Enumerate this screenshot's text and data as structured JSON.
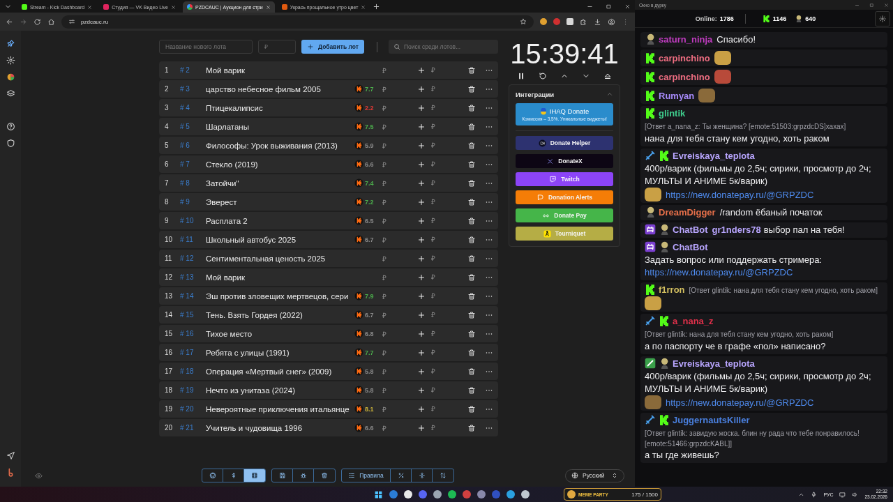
{
  "browser": {
    "tabs": [
      {
        "title": "Stream - Kick Dashboard",
        "selected": false
      },
      {
        "title": "Студия — VK Видео Live",
        "selected": false
      },
      {
        "title": "PZDCAUC | Аукцион для стри",
        "selected": true
      },
      {
        "title": "Укрась прощальное утро цвет",
        "selected": false
      }
    ],
    "address": "pzdcauc.ru"
  },
  "lot_form": {
    "name_placeholder": "Название нового лота",
    "amount_placeholder": "₽",
    "add_button": "Добавить лот",
    "search_placeholder": "Поиск среди лотов..."
  },
  "lots": [
    {
      "index": "1",
      "id": "# 2",
      "name": "Мой варик",
      "amount": "₽",
      "bid_placeholder": "₽"
    },
    {
      "index": "2",
      "id": "# 3",
      "name": "царство небесное фильм 2005",
      "rating": "7.7",
      "color": "#4cae4c",
      "amount": "₽",
      "bid_placeholder": "₽"
    },
    {
      "index": "3",
      "id": "# 4",
      "name": "Птицекалипсис",
      "rating": "2.2",
      "color": "#e53935",
      "amount": "₽",
      "bid_placeholder": "₽"
    },
    {
      "index": "4",
      "id": "# 5",
      "name": "Шарлатаны",
      "rating": "7.5",
      "color": "#4cae4c",
      "amount": "₽",
      "bid_placeholder": "₽"
    },
    {
      "index": "5",
      "id": "# 6",
      "name": "Философы: Урок выживания (2013)",
      "rating": "5.9",
      "color": "#8a8a8a",
      "amount": "₽",
      "bid_placeholder": "₽"
    },
    {
      "index": "6",
      "id": "# 7",
      "name": "Стекло (2019)",
      "rating": "6.6",
      "color": "#8a8a8a",
      "amount": "₽",
      "bid_placeholder": "₽"
    },
    {
      "index": "7",
      "id": "# 8",
      "name": "Затойчи\"",
      "rating": "7.4",
      "color": "#4cae4c",
      "amount": "₽",
      "bid_placeholder": "₽"
    },
    {
      "index": "8",
      "id": "# 9",
      "name": "Эверест",
      "rating": "7.2",
      "color": "#4cae4c",
      "amount": "₽",
      "bid_placeholder": "₽"
    },
    {
      "index": "9",
      "id": "# 10",
      "name": "Расплата 2",
      "rating": "6.5",
      "color": "#8a8a8a",
      "amount": "₽",
      "bid_placeholder": "₽"
    },
    {
      "index": "10",
      "id": "# 11",
      "name": "Школьный автобус 2025",
      "rating": "6.7",
      "color": "#8a8a8a",
      "amount": "₽",
      "bid_placeholder": "₽"
    },
    {
      "index": "11",
      "id": "# 12",
      "name": "Сентиментальная ценость 2025",
      "amount": "₽",
      "bid_placeholder": "₽"
    },
    {
      "index": "12",
      "id": "# 13",
      "name": "Мой варик",
      "amount": "₽",
      "bid_placeholder": "₽"
    },
    {
      "index": "13",
      "id": "# 14",
      "name": "Эш против зловещих мертвецов, сери",
      "rating": "7.9",
      "color": "#4cae4c",
      "amount": "₽",
      "bid_placeholder": "₽"
    },
    {
      "index": "14",
      "id": "# 15",
      "name": "Тень. Взять Гордея (2022)",
      "rating": "6.7",
      "color": "#8a8a8a",
      "amount": "₽",
      "bid_placeholder": "₽"
    },
    {
      "index": "15",
      "id": "# 16",
      "name": "Тихое место",
      "rating": "6.8",
      "color": "#8a8a8a",
      "amount": "₽",
      "bid_placeholder": "₽"
    },
    {
      "index": "16",
      "id": "# 17",
      "name": "Ребята с улицы (1991)",
      "rating": "7.7",
      "color": "#4cae4c",
      "amount": "₽",
      "bid_placeholder": "₽"
    },
    {
      "index": "17",
      "id": "# 18",
      "name": "Операция «Мертвый снег» (2009)",
      "rating": "5.8",
      "color": "#8a8a8a",
      "amount": "₽",
      "bid_placeholder": "₽"
    },
    {
      "index": "18",
      "id": "# 19",
      "name": "Нечто из унитаза (2024)",
      "rating": "5.8",
      "color": "#8a8a8a",
      "amount": "₽",
      "bid_placeholder": "₽"
    },
    {
      "index": "19",
      "id": "# 20",
      "name": "Невероятные приключения итальянце",
      "rating": "8.1",
      "color": "#c9b23a",
      "amount": "₽",
      "bid_placeholder": "₽"
    },
    {
      "index": "20",
      "id": "# 21",
      "name": "Учитель и чудовища 1996",
      "rating": "6.6",
      "color": "#8a8a8a",
      "amount": "₽",
      "bid_placeholder": "₽"
    }
  ],
  "timer": {
    "time": "15:39:41"
  },
  "integrations": {
    "title": "Интеграции",
    "expanded": true,
    "featured": {
      "name": "IHAQ Donate",
      "note": "Комиссия – 3,5%. Уникальные виджеты!"
    },
    "services": [
      {
        "name": "Donate Helper",
        "kind": "helper",
        "color": "#2d3270"
      },
      {
        "name": "DonateX",
        "kind": "x",
        "color": "#0d0614"
      },
      {
        "name": "Twitch",
        "kind": "twitch",
        "color": "#8c44f7"
      },
      {
        "name": "Donation Alerts",
        "kind": "alerts",
        "color": "#f57d07"
      },
      {
        "name": "Donate Pay",
        "kind": "pay",
        "color": "#45b549"
      },
      {
        "name": "Tourniquet",
        "kind": "tourniquet",
        "color": "#b5ad45"
      }
    ]
  },
  "toolbar": {
    "groups": [
      [
        {
          "kind": "github",
          "selected": false
        },
        {
          "kind": "dollar",
          "selected": false
        },
        {
          "kind": "film",
          "selected": true
        }
      ],
      [
        {
          "kind": "save",
          "selected": false
        },
        {
          "kind": "bug",
          "selected": false
        },
        {
          "kind": "trash",
          "selected": false
        }
      ],
      [
        {
          "kind": "rules",
          "label": "Правила",
          "selected": false
        },
        {
          "kind": "percent",
          "selected": false
        },
        {
          "kind": "split",
          "selected": false
        },
        {
          "kind": "sort",
          "selected": false
        }
      ]
    ]
  },
  "language": "Русский",
  "chat": {
    "window_title": "Окно в дурку",
    "online_label": "Online:",
    "online": "1786",
    "kick_viewers": "1146",
    "other_viewers": "640",
    "messages": [
      {
        "badges": [
          {
            "kind": "avatar"
          }
        ],
        "user": "saturn_ninja",
        "color": "#c03cc0",
        "text": "Спасибо!"
      },
      {
        "badges": [
          {
            "kind": "kick"
          }
        ],
        "user": "carpinchino",
        "color": "#f06e82",
        "emote": true
      },
      {
        "badges": [
          {
            "kind": "kick"
          }
        ],
        "user": "carpinchino",
        "color": "#f06e82",
        "emote": true
      },
      {
        "badges": [
          {
            "kind": "kick"
          }
        ],
        "user": "Rumyan",
        "color": "#a78bfa",
        "emote": true
      },
      {
        "badges": [
          {
            "kind": "kick"
          }
        ],
        "user": "glintik",
        "color": "#3fcf8e",
        "reply": "[Ответ a_nana_z: Ты женщина? [emote:51503:grpzdcDS]хахах]",
        "text": "нана для тебя стану кем угодно, хоть раком"
      },
      {
        "badges": [
          {
            "kind": "sword"
          },
          {
            "kind": "kick"
          }
        ],
        "user": "Evreiskaya_teplota",
        "color": "#b9a6ff",
        "text": "400р/варик (фильмы до 2,5ч; сирики, просмотр до 2ч; МУЛЬТЫ И АНИМЕ 5к/варик)",
        "emote": true,
        "link": "https://new.donatepay.ru/@GRPZDC"
      },
      {
        "badges": [
          {
            "kind": "avatar"
          }
        ],
        "user": "DreamDigger",
        "color": "#e8704a",
        "text": "/random ёбаный початок"
      },
      {
        "badges": [
          {
            "kind": "bot"
          },
          {
            "kind": "avatar"
          }
        ],
        "user": "ChatBot",
        "color": "#b9a6ff",
        "mention": "gr1nders78",
        "text": "выбор пал на тебя!"
      },
      {
        "badges": [
          {
            "kind": "bot"
          },
          {
            "kind": "avatar"
          }
        ],
        "user": "ChatBot",
        "color": "#b9a6ff",
        "text": "Задать вопрос или поддержать стримера:",
        "link": "https://new.donatepay.ru/@GRPZDC"
      },
      {
        "badges": [
          {
            "kind": "kick"
          }
        ],
        "user": "f1rron",
        "color": "#d4c060",
        "reply": "[Ответ glintik: нана для тебя стану кем угодно, хоть раком]",
        "emote": true
      },
      {
        "badges": [
          {
            "kind": "sword"
          },
          {
            "kind": "kick"
          }
        ],
        "user": "a_nana_z",
        "color": "#e0304a",
        "reply": "[Ответ glintik: нана для тебя стану кем угодно, хоть раком]",
        "text": "а по паспорту че в графе «пол» написано?"
      },
      {
        "badges": [
          {
            "kind": "check"
          },
          {
            "kind": "avatar"
          }
        ],
        "user": "Evreiskaya_teplota",
        "color": "#b9a6ff",
        "text": "400р/варик (фильмы до 2,5ч; сирики, просмотр до 2ч; МУЛЬТЫ И АНИМЕ 5к/варик)",
        "emote": true,
        "link": "https://new.donatepay.ru/@GRPZDC"
      },
      {
        "badges": [
          {
            "kind": "sword"
          },
          {
            "kind": "kick"
          }
        ],
        "user": "JuggernautsKiller",
        "color": "#4a80e0",
        "reply": "[Ответ glintik: завидую жоска. блин ну рада что тебе понравилось![emote:51466:grpzdcKABL]]",
        "text": "а ты где живешь?"
      }
    ]
  },
  "taskbar": {
    "widget_title": "MEME PARTY",
    "widget_count": "175 / 1500",
    "input_language": "РУС",
    "time": "22:32",
    "date": "23.02.2026"
  }
}
